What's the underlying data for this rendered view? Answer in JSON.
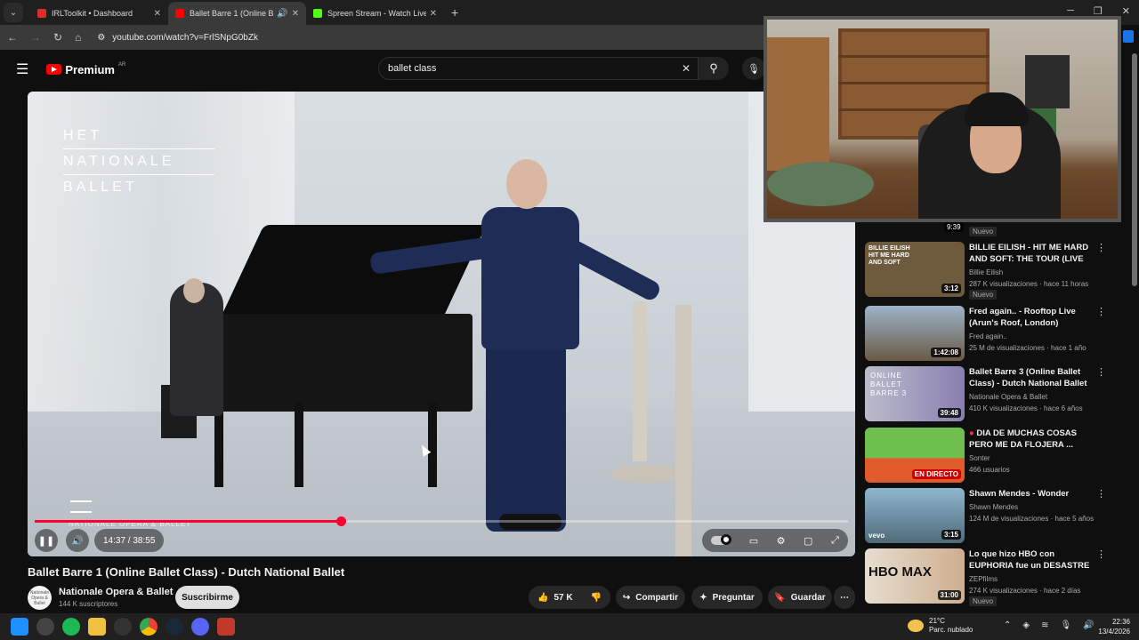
{
  "browser": {
    "tabs": [
      {
        "title": "IRLToolkit • Dashboard",
        "color": "#d93025",
        "active": false
      },
      {
        "title": "Ballet Barre 1 (Online Ballet",
        "color": "#ff0000",
        "active": true
      },
      {
        "title": "Spreen Stream - Watch Live on",
        "color": "#53fc18",
        "active": false
      }
    ],
    "url": "youtube.com/watch?v=FrlSNpG0bZk",
    "new_tab": "+"
  },
  "youtube": {
    "logo_text": "Premium",
    "region": "AR",
    "search_value": "ballet class",
    "icons": {
      "menu": "hamburger-icon",
      "search": "search-icon",
      "mic": "mic-icon"
    }
  },
  "video": {
    "overlay_brand": [
      "HET",
      "NATIONALE",
      "BALLET"
    ],
    "overlay_bottom": "NATIONALE OPERA & BALLET",
    "time": "14:37 / 38:55",
    "progress": 0.376,
    "title": "Ballet Barre 1 (Online Ballet Class) - Dutch National Ballet",
    "channel": "Nationale Opera & Ballet",
    "channel_avatar": "Nationale Opera & Ballet",
    "subscribers": "144 K suscriptores",
    "subscribe_label": "Suscribirme",
    "likes": "57 K",
    "share": "Compartir",
    "ask": "Preguntar",
    "save": "Guardar"
  },
  "sidebar": {
    "top_duration": "9:39",
    "top_badge": "Nuevo",
    "items": [
      {
        "title": "BILLIE EILISH - HIT ME HARD AND SOFT: THE TOUR (LIVE I...",
        "channel": "Billie Eilish",
        "meta": "287 K visualizaciones · hace 11 horas",
        "duration": "3:12",
        "badge": "Nuevo",
        "thumb": "#6e5a3c",
        "thumb_text": "BILLIE EILISH HIT ME HARD AND SOFT"
      },
      {
        "title": "Fred again.. - Rooftop Live (Arun's Roof, London)",
        "channel": "Fred again..",
        "meta": "25 M de visualizaciones · hace 1 año",
        "duration": "1:42:08",
        "badge": "",
        "thumb": "#7a8fa5",
        "thumb_text": ""
      },
      {
        "title": "Ballet Barre 3 (Online Ballet Class) - Dutch National Ballet",
        "channel": "Nationale Opera & Ballet",
        "meta": "410 K visualizaciones · hace 6 años",
        "duration": "39:48",
        "badge": "",
        "thumb": "#8a8fb0",
        "thumb_text": "ONLINE BALLET BARRE 3"
      },
      {
        "title": "DIA DE MUCHAS COSAS PERO ME DA FLOJERA ...",
        "channel": "Sonter",
        "meta": "466 usuarios",
        "duration": "EN DIRECTO",
        "badge": "",
        "thumb": "#5fa14a",
        "thumb_text": ""
      },
      {
        "title": "Shawn Mendes - Wonder",
        "channel": "Shawn Mendes",
        "meta": "124 M de visualizaciones · hace 5 años",
        "duration": "3:15",
        "badge": "",
        "thumb": "#5b8aa6",
        "thumb_text": "vevo"
      },
      {
        "title": "Lo que hizo HBO con EUPHORIA fue un DESASTRE",
        "channel": "ZEPfilms",
        "meta": "274 K visualizaciones · hace 2 días",
        "duration": "31:00",
        "badge": "Nuevo",
        "thumb": "#d9c7b0",
        "thumb_text": "HBO MAX"
      }
    ]
  },
  "taskbar": {
    "weather_temp": "21°C",
    "weather_desc": "Parc. nublado",
    "time": "22:36",
    "date": "13/4/2026"
  }
}
